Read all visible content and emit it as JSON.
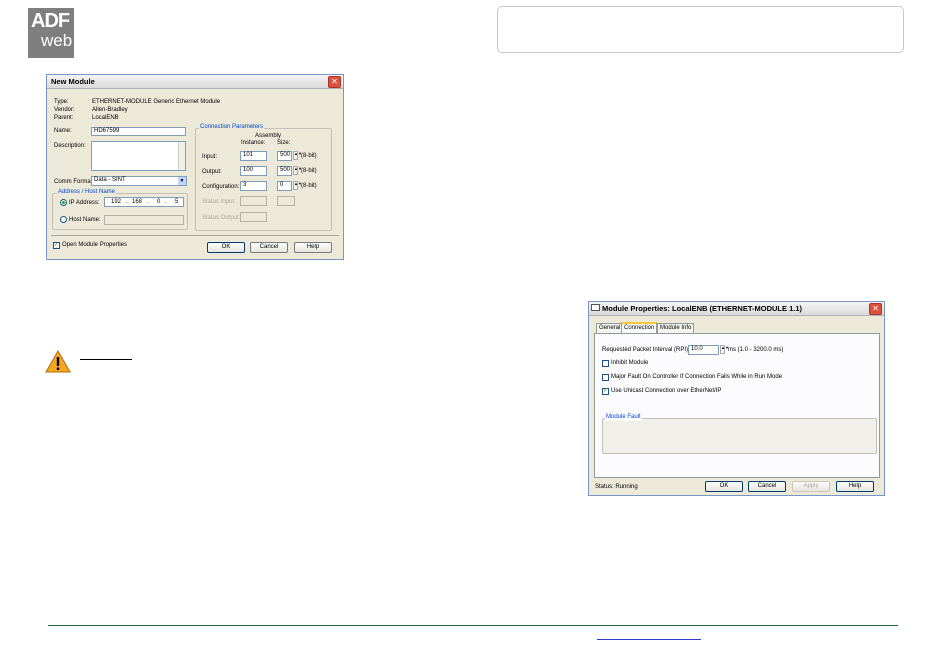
{
  "logo": {
    "line1": "ADF",
    "line2": "web"
  },
  "new_module": {
    "title": "New Module",
    "type_label": "Type:",
    "type_value": "ETHERNET-MODULE Generic Ethernet Module",
    "vendor_label": "Vendor:",
    "vendor_value": "Allen-Bradley",
    "parent_label": "Parent:",
    "parent_value": "LocalENB",
    "name_label": "Name:",
    "name_value": "HD67599",
    "description_label": "Description:",
    "comm_format_label": "Comm Format:",
    "comm_format_value": "Data - SINT",
    "address_group_title": "Address / Host Name",
    "ip_label": "IP Address:",
    "ip_octets": [
      "192",
      "168",
      "0",
      "5"
    ],
    "host_label": "Host Name:",
    "conn_group_title": "Connection Parameters",
    "col_assembly": "Assembly",
    "col_instance": "Instance:",
    "col_size": "Size:",
    "rows": [
      {
        "label": "Input:",
        "instance": "101",
        "size": "500",
        "unit": "(8-bit)"
      },
      {
        "label": "Output:",
        "instance": "100",
        "size": "500",
        "unit": "(8-bit)"
      },
      {
        "label": "Configuration:",
        "instance": "3",
        "size": "0",
        "unit": "(8-bit)"
      }
    ],
    "status_input_label": "Status Input:",
    "status_output_label": "Status Output:",
    "open_props_label": "Open Module Properties",
    "ok": "OK",
    "cancel": "Cancel",
    "help": "Help"
  },
  "module_props": {
    "title": "Module Properties: LocalENB (ETHERNET-MODULE 1.1)",
    "tabs": [
      "General",
      "Connection",
      "Module Info"
    ],
    "rpi_label": "Requested Packet Interval (RPI):",
    "rpi_value": "10.0",
    "rpi_unit": "ms  (1.0 - 3200.0 ms)",
    "inhibit_label": "Inhibit Module",
    "major_fault_label": "Major Fault On Controller If Connection Fails While in Run Mode",
    "unicast_label": "Use Unicast Connection over EtherNet/IP",
    "module_fault_title": "Module Fault",
    "status_text": "Status:  Running",
    "ok": "OK",
    "cancel": "Cancel",
    "apply": "Apply",
    "help": "Help"
  },
  "colors": {
    "accent_blue": "#0046d5",
    "footer_line": "#1f5f3f",
    "link": "#2c3fd0",
    "warning": "#f5a623"
  }
}
